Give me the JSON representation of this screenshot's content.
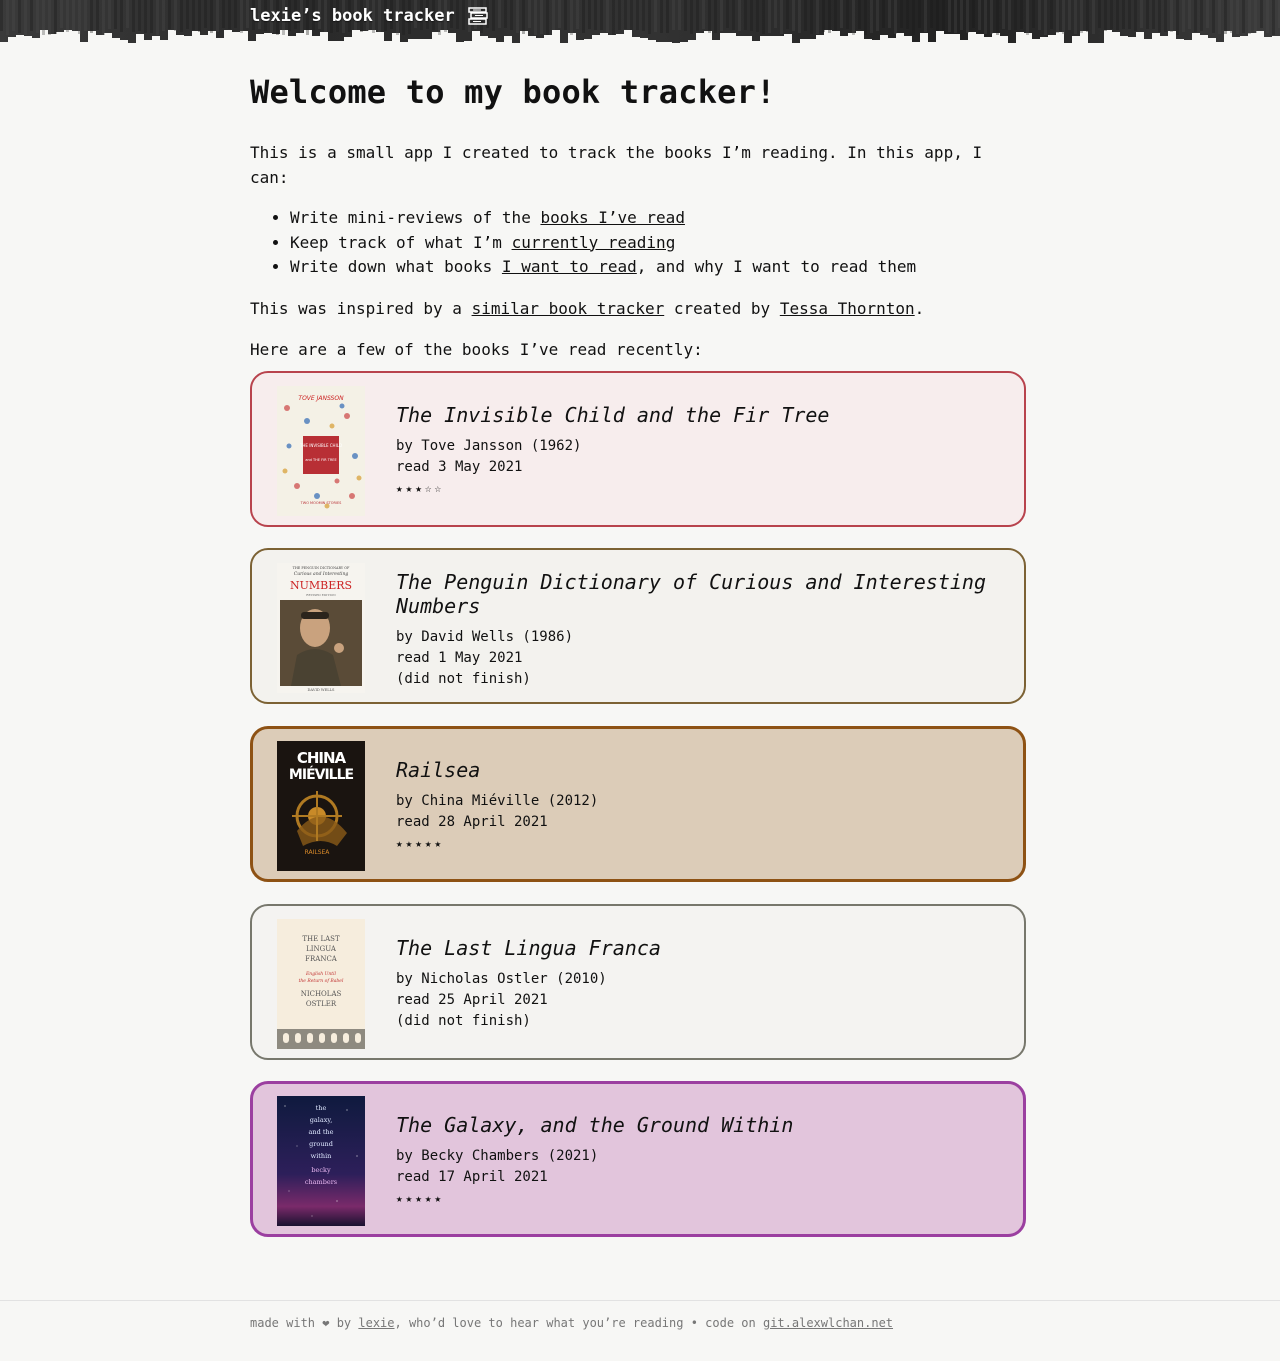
{
  "header": {
    "site_title": "lexie’s book tracker",
    "icon": "books-icon"
  },
  "intro": {
    "heading": "Welcome to my book tracker!",
    "p1": "This is a small app I created to track the books I’m reading. In this app, I can:",
    "list": [
      {
        "pre": "Write mini-reviews of the ",
        "link": "books I’ve read",
        "post": ""
      },
      {
        "pre": "Keep track of what I’m ",
        "link": "currently reading",
        "post": ""
      },
      {
        "pre": "Write down what books ",
        "link": "I want to read",
        "post": ", and why I want to read them"
      }
    ],
    "p2_pre": "This was inspired by a ",
    "p2_link1": "similar book tracker",
    "p2_mid": " created by ",
    "p2_link2": "Tessa Thornton",
    "p2_post": ".",
    "p3": "Here are a few of the books I’ve read recently:"
  },
  "books": [
    {
      "title": "The Invisible Child and the Fir Tree",
      "author_line": "by Tove Jansson (1962)",
      "read_line": "read 3 May 2021",
      "extra": "★★★☆☆",
      "rating_of_5": 3,
      "cover_text": [
        "TOVE JANSSON",
        "THE INVISIBLE CHILD",
        "and THE FIR TREE",
        "TWO MOOMIN STORIES"
      ],
      "colors": {
        "border": "#b8434d",
        "bg": "#f7eded"
      }
    },
    {
      "title": "The Penguin Dictionary of Curious and Interesting Numbers",
      "author_line": "by David Wells (1986)",
      "read_line": "read 1 May 2021",
      "extra": "(did not finish)",
      "cover_text": [
        "THE PENGUIN DICTIONARY OF",
        "Curious and Interesting",
        "NUMBERS",
        "REVISED EDITION",
        "DAVID WELLS"
      ],
      "colors": {
        "border": "#7c6234",
        "bg": "#f3f2ee"
      }
    },
    {
      "title": "Railsea",
      "author_line": "by China Miéville (2012)",
      "read_line": "read 28 April 2021",
      "extra": "★★★★★",
      "rating_of_5": 5,
      "cover_text": [
        "CHINA",
        "MIÉVILLE",
        "RAILSEA"
      ],
      "colors": {
        "border": "#8e5214",
        "bg": "#dcccb8"
      }
    },
    {
      "title": "The Last Lingua Franca",
      "author_line": "by Nicholas Ostler (2010)",
      "read_line": "read 25 April 2021",
      "extra": "(did not finish)",
      "cover_text": [
        "THE LAST",
        "LINGUA",
        "FRANCA",
        "English Until",
        "the Return of Babel",
        "NICHOLAS",
        "OSTLER"
      ],
      "colors": {
        "border": "#77776c",
        "bg": "#f4f3f1"
      }
    },
    {
      "title": "The Galaxy, and the Ground Within",
      "author_line": "by Becky Chambers (2021)",
      "read_line": "read 17 April 2021",
      "extra": "★★★★★",
      "rating_of_5": 5,
      "cover_text": [
        "the",
        "galaxy,",
        "and the",
        "ground",
        "within",
        "becky",
        "chambers"
      ],
      "colors": {
        "border": "#9b3fa0",
        "bg": "#e2c5dc"
      }
    }
  ],
  "footer": {
    "pre": "made with ❤ by ",
    "link1": "lexie",
    "mid": ", who’d love to hear what you’re reading • code on ",
    "link2": "git.alexwlchan.net"
  }
}
